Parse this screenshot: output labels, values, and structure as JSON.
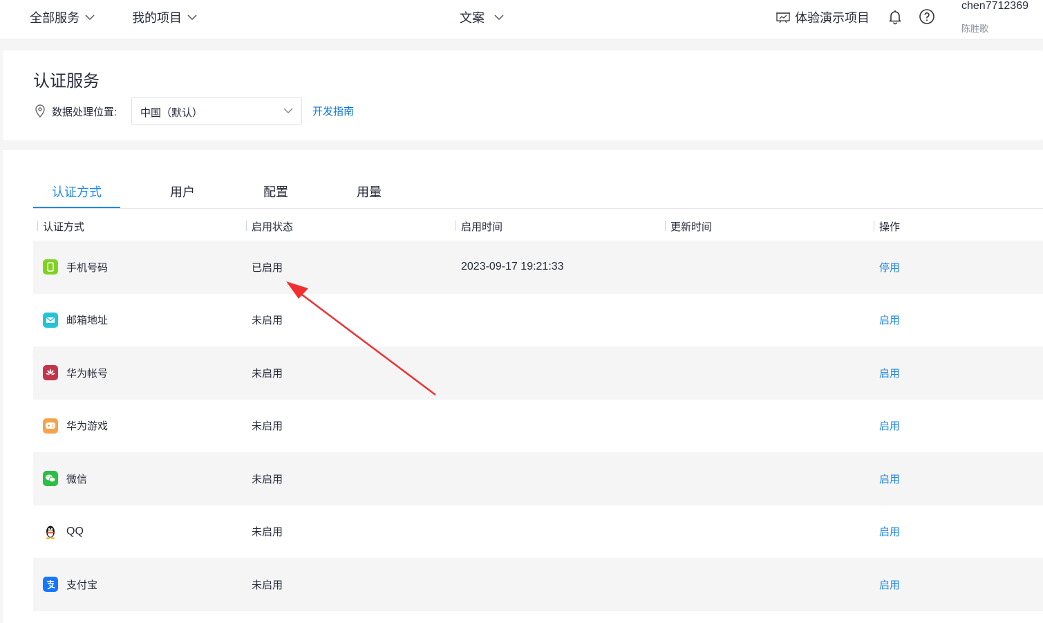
{
  "topbar": {
    "all_services": "全部服务",
    "my_projects": "我的项目",
    "project": "文案",
    "demo_project": "体验演示项目",
    "user_name": "chen7712369",
    "user_sub": "陈胜歌"
  },
  "header": {
    "title": "认证服务",
    "location_label": "数据处理位置:",
    "region_value": "中国（默认）",
    "dev_guide": "开发指南"
  },
  "tabs": [
    "认证方式",
    "用户",
    "配置",
    "用量"
  ],
  "table": {
    "columns": [
      "认证方式",
      "启用状态",
      "启用时间",
      "更新时间",
      "操作"
    ],
    "rows": [
      {
        "method": "手机号码",
        "status": "已启用",
        "time": "2023-09-17 19:21:33",
        "updated": "",
        "op": "停用",
        "icon": "phone-icon",
        "color": "#7ed321"
      },
      {
        "method": "邮箱地址",
        "status": "未启用",
        "time": "",
        "updated": "",
        "op": "启用",
        "icon": "email-icon",
        "color": "#21c4d8"
      },
      {
        "method": "华为帐号",
        "status": "未启用",
        "time": "",
        "updated": "",
        "op": "启用",
        "icon": "huawei-icon",
        "color": "#c4344a"
      },
      {
        "method": "华为游戏",
        "status": "未启用",
        "time": "",
        "updated": "",
        "op": "启用",
        "icon": "gamepad-icon",
        "color": "#f5a34b"
      },
      {
        "method": "微信",
        "status": "未启用",
        "time": "",
        "updated": "",
        "op": "启用",
        "icon": "wechat-icon",
        "color": "#2ac046"
      },
      {
        "method": "QQ",
        "status": "未启用",
        "time": "",
        "updated": "",
        "op": "启用",
        "icon": "qq-penguin-icon",
        "color": "#222222"
      },
      {
        "method": "支付宝",
        "status": "未启用",
        "time": "",
        "updated": "",
        "op": "启用",
        "icon": "alipay-icon",
        "color": "#1677ff"
      }
    ]
  },
  "colors": {
    "accent": "#1e88e5",
    "annotation_arrow": "#f03030"
  }
}
